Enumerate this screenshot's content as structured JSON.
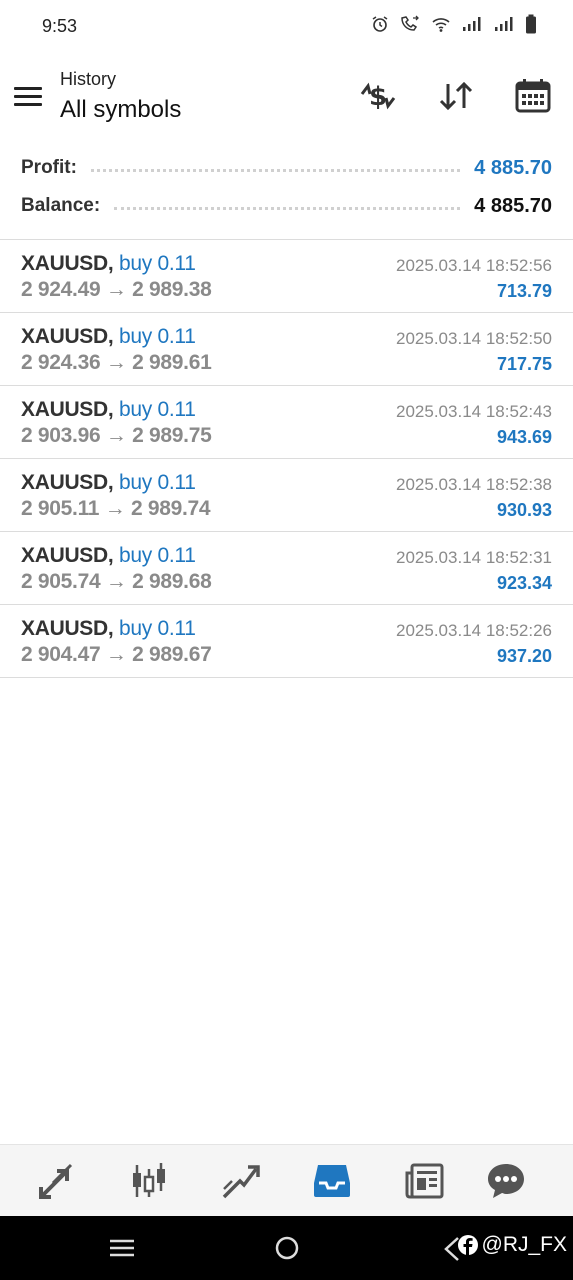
{
  "status_bar": {
    "time": "9:53"
  },
  "header": {
    "small_title": "History",
    "title": "All symbols",
    "icons": [
      "currency-swap-icon",
      "sort-icon",
      "calendar-icon"
    ]
  },
  "summary": {
    "profit_label": "Profit:",
    "profit_value": "4 885.70",
    "balance_label": "Balance:",
    "balance_value": "4 885.70",
    "profit_color": "#1f77c0"
  },
  "deals": [
    {
      "symbol": "XAUUSD,",
      "type": "buy 0.11",
      "prices": "2 924.49 → 2 989.38",
      "time": "2025.03.14 18:52:56",
      "profit": "713.79"
    },
    {
      "symbol": "XAUUSD,",
      "type": "buy 0.11",
      "prices": "2 924.36 → 2 989.61",
      "time": "2025.03.14 18:52:50",
      "profit": "717.75"
    },
    {
      "symbol": "XAUUSD,",
      "type": "buy 0.11",
      "prices": "2 903.96 → 2 989.75",
      "time": "2025.03.14 18:52:43",
      "profit": "943.69"
    },
    {
      "symbol": "XAUUSD,",
      "type": "buy 0.11",
      "prices": "2 905.11 → 2 989.74",
      "time": "2025.03.14 18:52:38",
      "profit": "930.93"
    },
    {
      "symbol": "XAUUSD,",
      "type": "buy 0.11",
      "prices": "2 905.74 → 2 989.68",
      "time": "2025.03.14 18:52:31",
      "profit": "923.34"
    },
    {
      "symbol": "XAUUSD,",
      "type": "buy 0.11",
      "prices": "2 904.47 → 2 989.67",
      "time": "2025.03.14 18:52:26",
      "profit": "937.20"
    }
  ],
  "tabbar": {
    "tabs": [
      "quotes-icon",
      "chart-icon",
      "trade-icon",
      "history-icon",
      "news-icon",
      "chat-icon"
    ],
    "active": "history-icon",
    "active_color": "#1f77c0"
  },
  "navbar": {
    "watermark": "@RJ_FX"
  }
}
